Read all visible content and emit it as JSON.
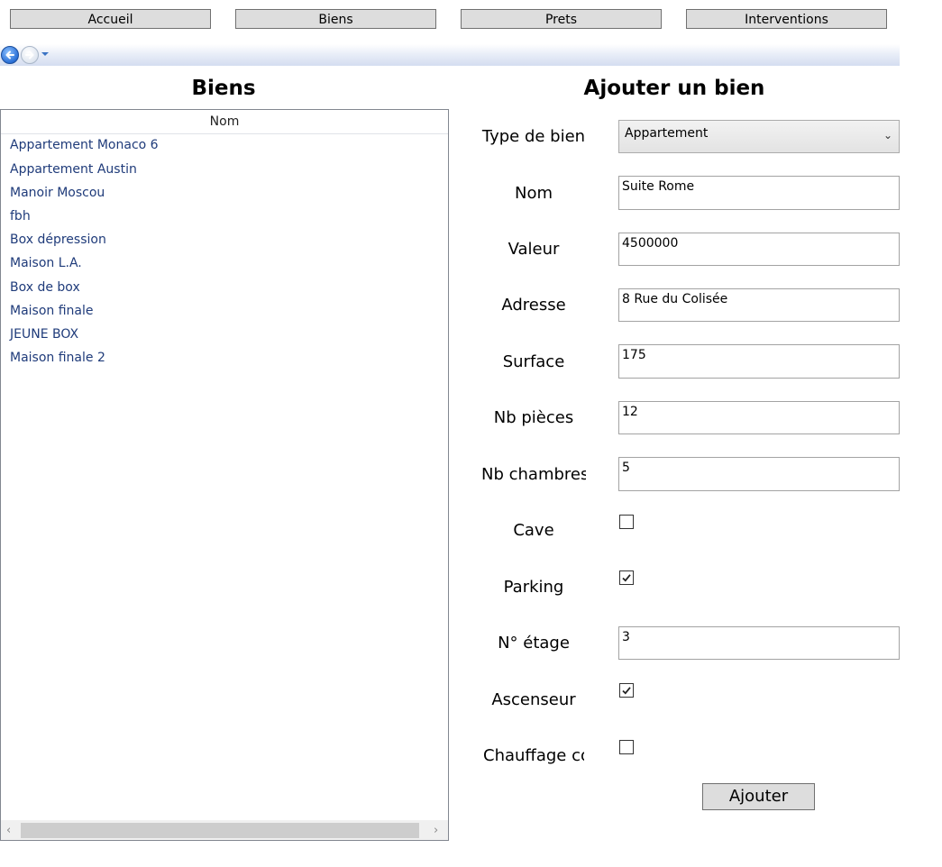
{
  "nav": {
    "buttons": [
      "Accueil",
      "Biens",
      "Prets",
      "Interventions"
    ]
  },
  "icons": {
    "back": "back-arrow-icon",
    "forward": "forward-arrow-icon",
    "history": "history-dropdown-icon"
  },
  "list_section": {
    "title": "Biens",
    "column_header": "Nom",
    "items": [
      "Appartement Monaco 6",
      "Appartement Austin",
      "Manoir Moscou",
      "fbh",
      "Box dépression",
      "Maison L.A.",
      "Box de box",
      "Maison finale",
      "JEUNE BOX",
      "Maison finale 2"
    ]
  },
  "form": {
    "title": "Ajouter un bien",
    "type_label": "Type de bien",
    "type_value": "Appartement",
    "nom_label": "Nom",
    "nom_value": "Suite Rome",
    "valeur_label": "Valeur",
    "valeur_value": "4500000",
    "adresse_label": "Adresse",
    "adresse_value": "8 Rue du Colisée",
    "surface_label": "Surface",
    "surface_value": "175",
    "pieces_label": "Nb pièces",
    "pieces_value": "12",
    "chambres_label": "Nb chambres",
    "chambres_value": "5",
    "cave_label": "Cave",
    "cave_checked": false,
    "parking_label": "Parking",
    "parking_checked": true,
    "etage_label": "N° étage",
    "etage_value": "3",
    "ascenseur_label": "Ascenseur",
    "ascenseur_checked": true,
    "chauffage_label": "Chauffage commun",
    "chauffage_checked": false,
    "submit_label": "Ajouter"
  },
  "colors": {
    "list_text": "#1f3b7a",
    "button_bg": "#dddddd"
  }
}
